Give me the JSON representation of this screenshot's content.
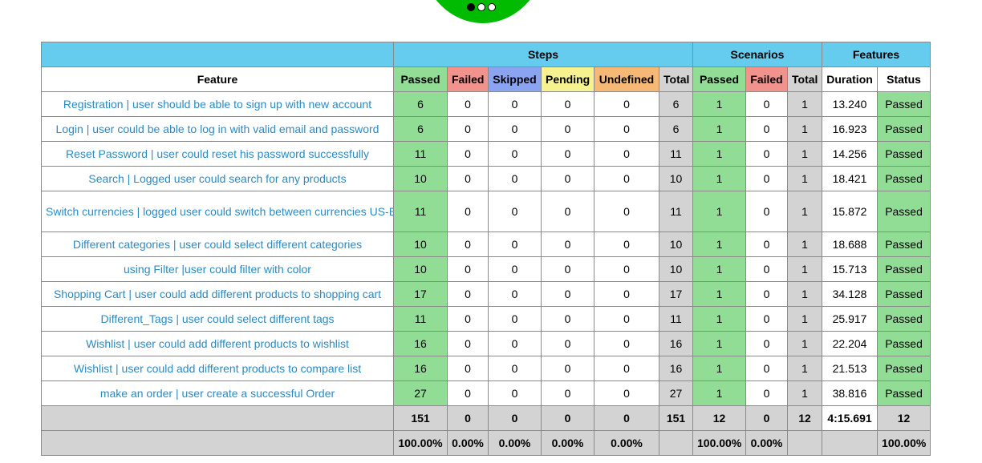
{
  "carousel": {
    "active_index": 0,
    "count": 3
  },
  "headers": {
    "group_steps": "Steps",
    "group_scenarios": "Scenarios",
    "group_features": "Features",
    "feature": "Feature",
    "steps_passed": "Passed",
    "steps_failed": "Failed",
    "steps_skipped": "Skipped",
    "steps_pending": "Pending",
    "steps_undefined": "Undefined",
    "steps_total": "Total",
    "scen_passed": "Passed",
    "scen_failed": "Failed",
    "scen_total": "Total",
    "duration": "Duration",
    "status": "Status"
  },
  "rows": [
    {
      "feature": "Registration | user should be able to sign up with new account",
      "passed": "6",
      "failed": "0",
      "skipped": "0",
      "pending": "0",
      "undefined": "0",
      "total": "6",
      "s_passed": "1",
      "s_failed": "0",
      "s_total": "1",
      "duration": "13.240",
      "status": "Passed"
    },
    {
      "feature": "Login | user could be able to log in with valid email and password",
      "passed": "6",
      "failed": "0",
      "skipped": "0",
      "pending": "0",
      "undefined": "0",
      "total": "6",
      "s_passed": "1",
      "s_failed": "0",
      "s_total": "1",
      "duration": "16.923",
      "status": "Passed"
    },
    {
      "feature": "Reset Password | user could reset his password successfully",
      "passed": "11",
      "failed": "0",
      "skipped": "0",
      "pending": "0",
      "undefined": "0",
      "total": "11",
      "s_passed": "1",
      "s_failed": "0",
      "s_total": "1",
      "duration": "14.256",
      "status": "Passed"
    },
    {
      "feature": "Search | Logged user could search for any products",
      "passed": "10",
      "failed": "0",
      "skipped": "0",
      "pending": "0",
      "undefined": "0",
      "total": "10",
      "s_passed": "1",
      "s_failed": "0",
      "s_total": "1",
      "duration": "18.421",
      "status": "Passed"
    },
    {
      "feature": "Switch currencies | logged user could switch between currencies US-Euro",
      "passed": "11",
      "failed": "0",
      "skipped": "0",
      "pending": "0",
      "undefined": "0",
      "total": "11",
      "s_passed": "1",
      "s_failed": "0",
      "s_total": "1",
      "duration": "15.872",
      "status": "Passed"
    },
    {
      "feature": "Different categories | user could select different categories",
      "passed": "10",
      "failed": "0",
      "skipped": "0",
      "pending": "0",
      "undefined": "0",
      "total": "10",
      "s_passed": "1",
      "s_failed": "0",
      "s_total": "1",
      "duration": "18.688",
      "status": "Passed"
    },
    {
      "feature": "using Filter |user could filter with color",
      "passed": "10",
      "failed": "0",
      "skipped": "0",
      "pending": "0",
      "undefined": "0",
      "total": "10",
      "s_passed": "1",
      "s_failed": "0",
      "s_total": "1",
      "duration": "15.713",
      "status": "Passed"
    },
    {
      "feature": "Shopping Cart | user could add different products to shopping cart",
      "passed": "17",
      "failed": "0",
      "skipped": "0",
      "pending": "0",
      "undefined": "0",
      "total": "17",
      "s_passed": "1",
      "s_failed": "0",
      "s_total": "1",
      "duration": "34.128",
      "status": "Passed"
    },
    {
      "feature": "Different_Tags | user could select different tags",
      "passed": "11",
      "failed": "0",
      "skipped": "0",
      "pending": "0",
      "undefined": "0",
      "total": "11",
      "s_passed": "1",
      "s_failed": "0",
      "s_total": "1",
      "duration": "25.917",
      "status": "Passed"
    },
    {
      "feature": "Wishlist | user could add different products to wishlist",
      "passed": "16",
      "failed": "0",
      "skipped": "0",
      "pending": "0",
      "undefined": "0",
      "total": "16",
      "s_passed": "1",
      "s_failed": "0",
      "s_total": "1",
      "duration": "22.204",
      "status": "Passed"
    },
    {
      "feature": "Wishlist | user could add different products to compare list",
      "passed": "16",
      "failed": "0",
      "skipped": "0",
      "pending": "0",
      "undefined": "0",
      "total": "16",
      "s_passed": "1",
      "s_failed": "0",
      "s_total": "1",
      "duration": "21.513",
      "status": "Passed"
    },
    {
      "feature": "make an order | user create a successful Order",
      "passed": "27",
      "failed": "0",
      "skipped": "0",
      "pending": "0",
      "undefined": "0",
      "total": "27",
      "s_passed": "1",
      "s_failed": "0",
      "s_total": "1",
      "duration": "38.816",
      "status": "Passed"
    }
  ],
  "totals": {
    "passed": "151",
    "failed": "0",
    "skipped": "0",
    "pending": "0",
    "undefined": "0",
    "total": "151",
    "s_passed": "12",
    "s_failed": "0",
    "s_total": "12",
    "duration": "4:15.691",
    "status": "12"
  },
  "percentages": {
    "passed": "100.00%",
    "failed": "0.00%",
    "skipped": "0.00%",
    "pending": "0.00%",
    "undefined": "0.00%",
    "s_passed": "100.00%",
    "s_failed": "0.00%",
    "status": "100.00%"
  },
  "colors": {
    "header_blue": "#66ccee",
    "passed_green": "#92dd96",
    "failed_red": "#f2928c",
    "skipped_blue": "#8aa4f2",
    "pending_yellow": "#f5f28f",
    "undefined_orange": "#f5b975",
    "total_gray": "#d3d3d3",
    "link_blue": "#2a8bc5",
    "chart_green": "#00bb00"
  }
}
